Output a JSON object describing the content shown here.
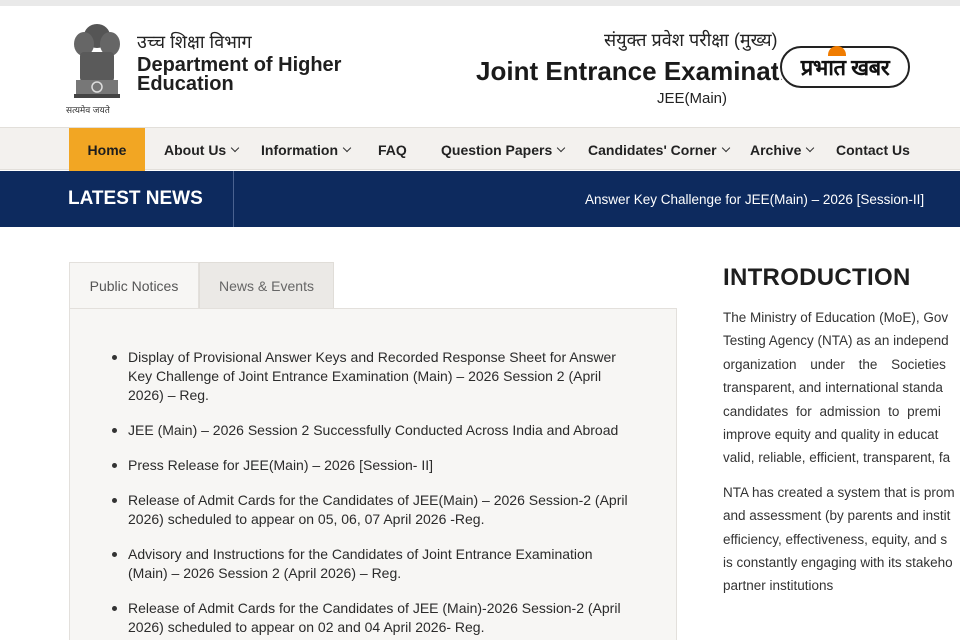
{
  "header": {
    "dept_hindi": "उच्च शिक्षा विभाग",
    "dept_name": "Department of Higher Education",
    "emblem_motto": "सत्यमेव जयते",
    "exam_hindi": "संयुक्त प्रवेश परीक्षा (मुख्य)",
    "exam_title": "Joint Entrance Examination (Main)",
    "exam_sub": "JEE(Main)",
    "badge_text": "प्रभात खबर"
  },
  "nav": {
    "items": [
      {
        "label": "Home"
      },
      {
        "label": "About Us"
      },
      {
        "label": "Information"
      },
      {
        "label": "FAQ"
      },
      {
        "label": "Question Papers"
      },
      {
        "label": "Candidates' Corner"
      },
      {
        "label": "Archive"
      },
      {
        "label": "Contact Us"
      }
    ]
  },
  "news": {
    "label": "LATEST NEWS",
    "ticker": "Answer Key Challenge for JEE(Main) – 2026 [Session-II]"
  },
  "tabs": [
    {
      "label": "Public Notices"
    },
    {
      "label": "News & Events"
    }
  ],
  "notices": [
    "Display of Provisional Answer Keys and Recorded Response Sheet for Answer Key Challenge of Joint Entrance Examination (Main) – 2026 Session 2 (April 2026) – Reg.",
    "JEE (Main) – 2026 Session 2 Successfully Conducted Across India and Abroad",
    "Press Release for JEE(Main) – 2026 [Session- II]",
    "Release of Admit Cards for the Candidates of JEE(Main) – 2026 Session-2 (April 2026) scheduled to appear on 05, 06, 07 April 2026 -Reg.",
    "Advisory and Instructions for the Candidates of Joint Entrance Examination (Main) – 2026 Session 2 (April 2026) – Reg.",
    "Release of Admit Cards for the Candidates of JEE (Main)-2026 Session-2 (April 2026) scheduled to appear on 02 and 04 April 2026- Reg."
  ],
  "intro": {
    "title": "INTRODUCTION",
    "para1_lines": [
      "The Ministry of Education (MoE), Gov",
      "Testing Agency (NTA) as an independ",
      "organization under the Societies",
      "transparent, and international standa",
      "candidates for admission to premi",
      "improve equity and quality in educat",
      "valid, reliable, efficient, transparent, fa"
    ],
    "para2_lines": [
      "NTA has created a system that is prom",
      "and assessment (by parents and instit",
      "efficiency, effectiveness, equity, and s",
      "is constantly engaging with its stakeho",
      "partner institutions"
    ]
  },
  "colors": {
    "nav_active": "#f2a623",
    "news_bar": "#0d2a5e",
    "badge_accent": "#f07c00"
  }
}
